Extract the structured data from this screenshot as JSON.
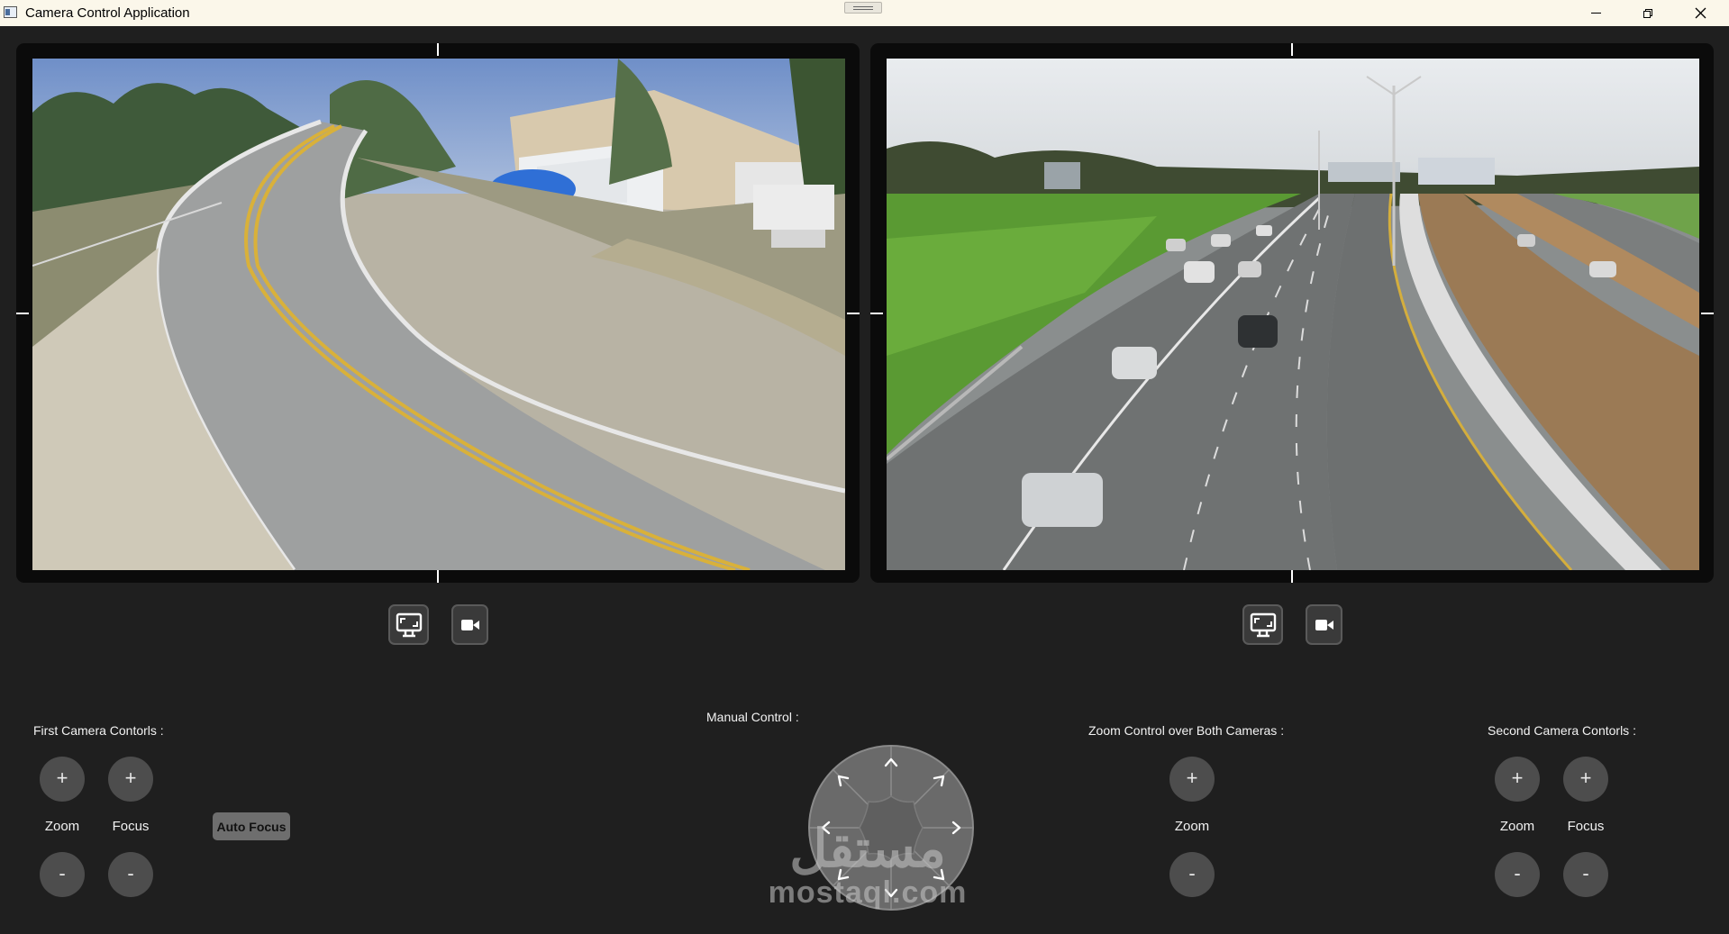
{
  "window": {
    "title": "Camera Control Application",
    "icon": "app-window-icon",
    "controls": [
      "minimize-icon",
      "restore-icon",
      "close-icon"
    ]
  },
  "cameras": {
    "first": {
      "feed": "curved coastal road with yellow center lines, houses and palm trees",
      "buttons": [
        "fullscreen-monitor-icon",
        "video-record-icon"
      ]
    },
    "second": {
      "feed": "multi-lane highway with cars, grass embankment and street lights",
      "buttons": [
        "fullscreen-monitor-icon",
        "video-record-icon"
      ]
    }
  },
  "first_controls": {
    "title": "First Camera Contorls :",
    "plus": "+",
    "minus": "-",
    "zoom_label": "Zoom",
    "focus_label": "Focus",
    "auto_focus_label": "Auto Focus"
  },
  "manual": {
    "title": "Manual Control :",
    "directions": [
      "up",
      "up-right",
      "right",
      "down-right",
      "down",
      "down-left",
      "left",
      "up-left"
    ]
  },
  "zoom_both": {
    "title": "Zoom Control over Both Cameras :",
    "plus": "+",
    "minus": "-",
    "zoom_label": "Zoom"
  },
  "second_controls": {
    "title": "Second Camera Contorls :",
    "plus": "+",
    "minus": "-",
    "zoom_label": "Zoom",
    "focus_label": "Focus"
  },
  "watermark": {
    "arabic": "مستقل",
    "latin": "mostaql.com"
  },
  "colors": {
    "background": "#1f1f1f",
    "titlebar": "#fbf7ea",
    "round_button": "#4d4d4d",
    "auto_focus_button": "#6e6e6e"
  }
}
